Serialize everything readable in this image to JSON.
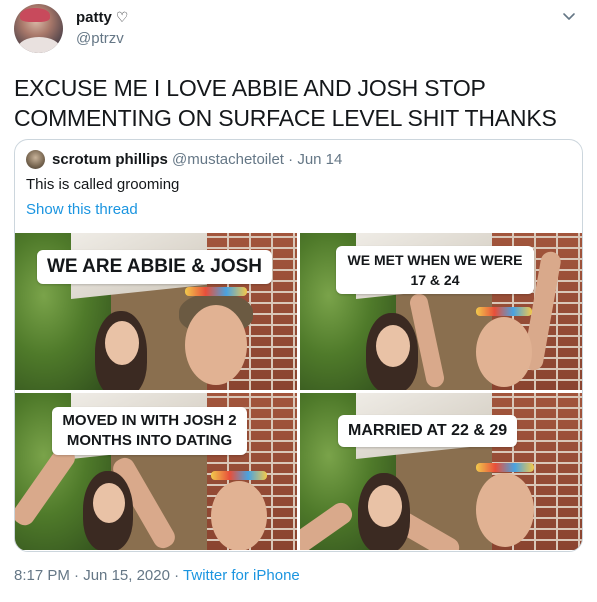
{
  "author": {
    "name": "patty",
    "heart": "♡",
    "handle": "@ptrzv"
  },
  "tweet": {
    "text": "EXCUSE ME I LOVE ABBIE AND JOSH STOP COMMENTING ON SURFACE LEVEL SHIT THANKS"
  },
  "quoted": {
    "name": "scrotum phillips",
    "handle": "@mustachetoilet",
    "separator": "·",
    "date": "Jun 14",
    "text": "This is called grooming",
    "show_thread": "Show this thread",
    "media_captions": [
      "WE ARE ABBIE & JOSH",
      "WE MET WHEN WE WERE 17 & 24",
      "MOVED IN WITH JOSH 2 MONTHS INTO DATING",
      "MARRIED AT 22 & 29"
    ]
  },
  "footer": {
    "time": "8:17 PM",
    "separator": "·",
    "date": "Jun 15, 2020",
    "separator2": "·",
    "source": "Twitter for iPhone"
  },
  "colors": {
    "text": "#14171a",
    "secondary": "#657786",
    "link": "#1b95e0",
    "border": "#ccd6dd"
  },
  "icons": [
    "chevron-down-icon",
    "heart-icon"
  ]
}
